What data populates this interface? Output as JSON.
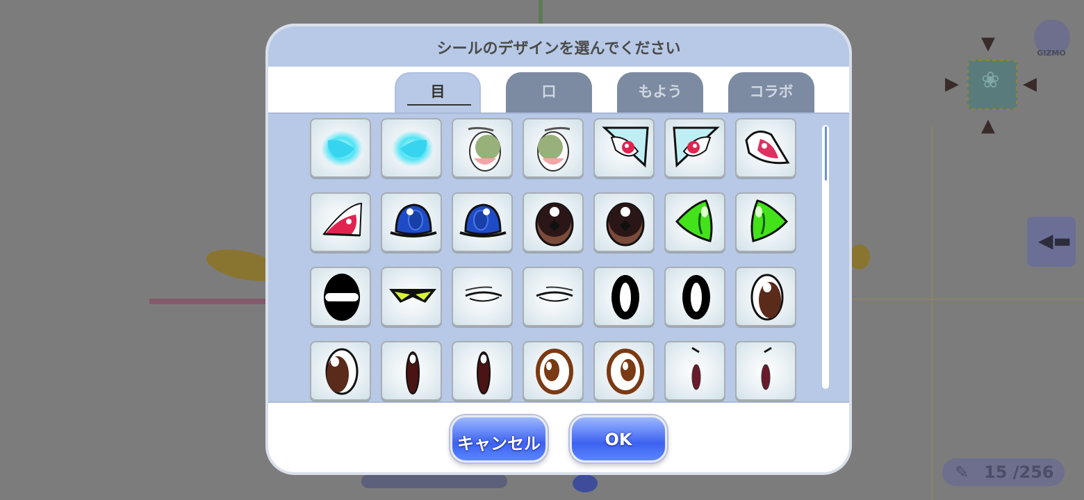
{
  "dialog": {
    "title": "シールのデザインを選んでください",
    "tabs": [
      {
        "label": "目",
        "active": true
      },
      {
        "label": "口",
        "active": false
      },
      {
        "label": "もよう",
        "active": false
      },
      {
        "label": "コラボ",
        "active": false
      }
    ],
    "cancel_label": "キャンセル",
    "ok_label": "OK"
  },
  "eye_designs": [
    "cyan-glow-eye-left",
    "cyan-glow-eye-right",
    "green-oval-eye-left",
    "green-oval-eye-right",
    "white-red-sharp-eye-left",
    "white-red-sharp-eye-right",
    "red-sharp-eye",
    "red-slant-eye",
    "blue-dome-eye-left",
    "blue-dome-eye-right",
    "dark-brown-eye-left",
    "dark-brown-eye-right",
    "green-cat-eye-left",
    "green-cat-eye-right",
    "black-slit-eye",
    "yellow-visor-eyes",
    "closed-lash-eye-left",
    "closed-lash-eye-right",
    "black-ring-eye-left",
    "black-ring-eye-right",
    "brown-oval-eye",
    "brown-oval-eye-2",
    "dark-red-slim-eye-left",
    "dark-red-slim-eye-right",
    "brown-ring-eye-left",
    "brown-ring-eye-right",
    "small-dark-eye-left",
    "small-dark-eye-right"
  ],
  "background": {
    "gizmo_label": "GIZMO",
    "counter": "15 /256"
  }
}
